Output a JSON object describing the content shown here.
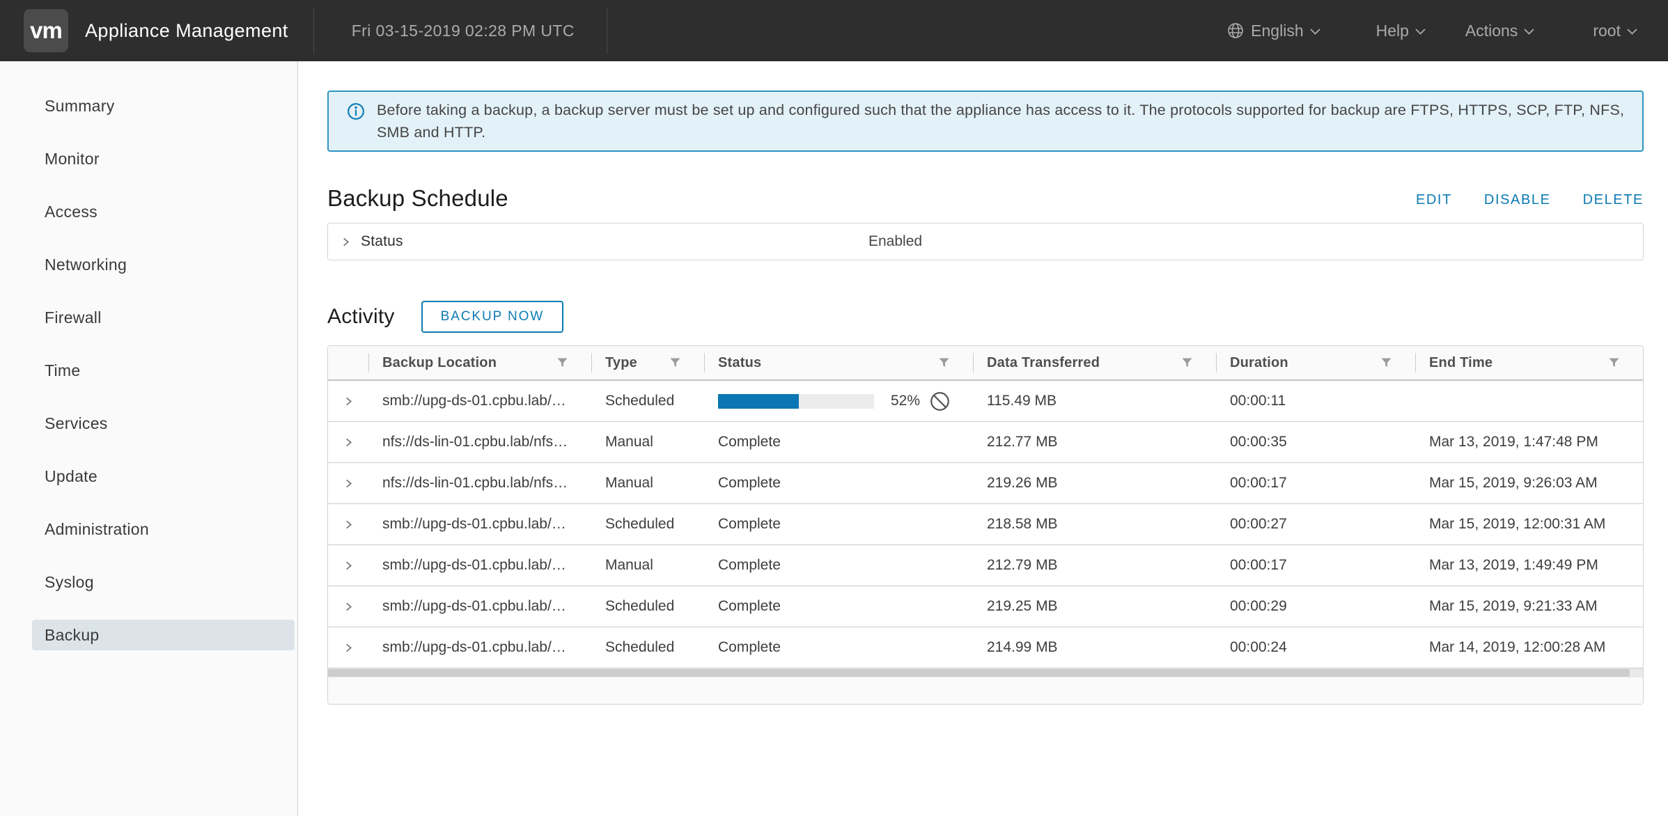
{
  "topbar": {
    "logo": "vm",
    "title": "Appliance Management",
    "datetime": "Fri 03-15-2019 02:28 PM UTC",
    "language": "English",
    "help": "Help",
    "actions": "Actions",
    "user": "root"
  },
  "sidebar": {
    "items": [
      {
        "label": "Summary"
      },
      {
        "label": "Monitor"
      },
      {
        "label": "Access"
      },
      {
        "label": "Networking"
      },
      {
        "label": "Firewall"
      },
      {
        "label": "Time"
      },
      {
        "label": "Services"
      },
      {
        "label": "Update"
      },
      {
        "label": "Administration"
      },
      {
        "label": "Syslog"
      },
      {
        "label": "Backup",
        "selected": true
      }
    ]
  },
  "banner": {
    "text": "Before taking a backup, a backup server must be set up and configured such that the appliance has access to it. The protocols supported for backup are FTPS, HTTPS, SCP, FTP, NFS, SMB and HTTP."
  },
  "backup_schedule": {
    "title": "Backup Schedule",
    "edit_label": "EDIT",
    "disable_label": "DISABLE",
    "delete_label": "DELETE",
    "status_label": "Status",
    "status_value": "Enabled"
  },
  "activity": {
    "title": "Activity",
    "backup_now_label": "BACKUP NOW",
    "columns": [
      "Backup Location",
      "Type",
      "Status",
      "Data Transferred",
      "Duration",
      "End Time"
    ],
    "rows": [
      {
        "location": "smb://upg-ds-01.cpbu.lab/…",
        "type": "Scheduled",
        "status": "In progress",
        "progress_percent": 52,
        "progress_label": "52%",
        "data_transferred": "115.49 MB",
        "duration": "00:00:11",
        "end_time": ""
      },
      {
        "location": "nfs://ds-lin-01.cpbu.lab/nfs…",
        "type": "Manual",
        "status": "Complete",
        "data_transferred": "212.77 MB",
        "duration": "00:00:35",
        "end_time": "Mar 13, 2019, 1:47:48 PM"
      },
      {
        "location": "nfs://ds-lin-01.cpbu.lab/nfs…",
        "type": "Manual",
        "status": "Complete",
        "data_transferred": "219.26 MB",
        "duration": "00:00:17",
        "end_time": "Mar 15, 2019, 9:26:03 AM"
      },
      {
        "location": "smb://upg-ds-01.cpbu.lab/…",
        "type": "Scheduled",
        "status": "Complete",
        "data_transferred": "218.58 MB",
        "duration": "00:00:27",
        "end_time": "Mar 15, 2019, 12:00:31 AM"
      },
      {
        "location": "smb://upg-ds-01.cpbu.lab/…",
        "type": "Manual",
        "status": "Complete",
        "data_transferred": "212.79 MB",
        "duration": "00:00:17",
        "end_time": "Mar 13, 2019, 1:49:49 PM"
      },
      {
        "location": "smb://upg-ds-01.cpbu.lab/…",
        "type": "Scheduled",
        "status": "Complete",
        "data_transferred": "219.25 MB",
        "duration": "00:00:29",
        "end_time": "Mar 15, 2019, 9:21:33 AM"
      },
      {
        "location": "smb://upg-ds-01.cpbu.lab/…",
        "type": "Scheduled",
        "status": "Complete",
        "data_transferred": "214.99 MB",
        "duration": "00:00:24",
        "end_time": "Mar 14, 2019, 12:00:28 AM"
      }
    ]
  },
  "colors": {
    "accent_blue": "#0c7bb3",
    "topbar_bg": "#2e2e2e",
    "sidebar_selected_bg": "#dce4ea",
    "banner_bg": "#e3f1f8",
    "banner_border": "#2e93c2",
    "progress_fill": "#0b76b3",
    "progress_track": "#ececec"
  }
}
